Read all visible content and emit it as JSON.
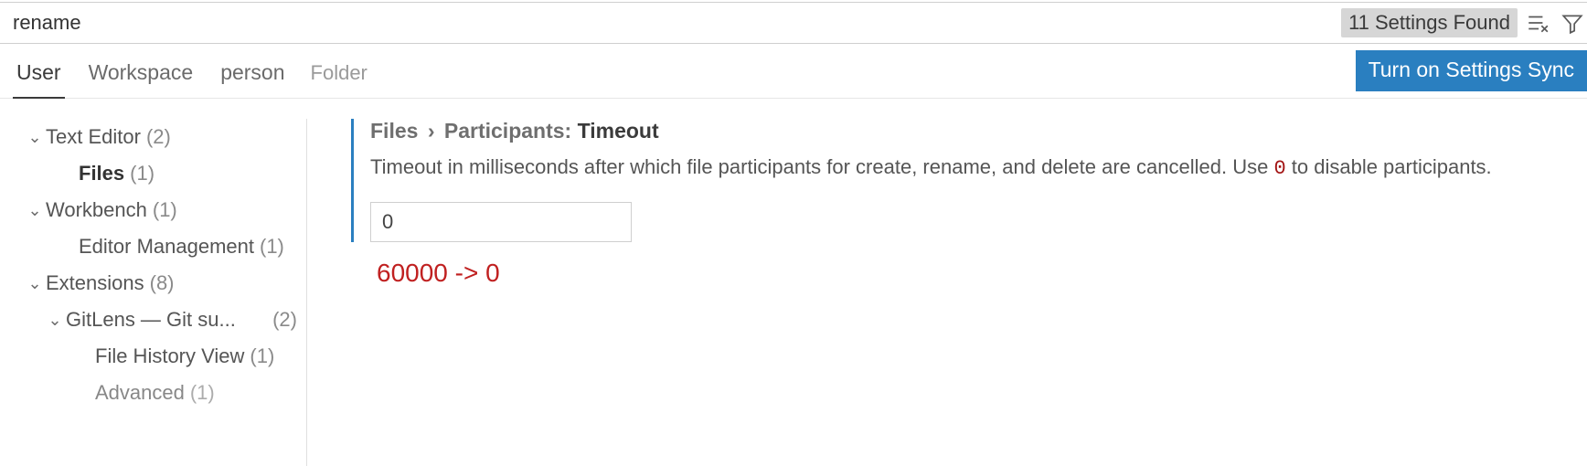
{
  "search": {
    "value": "rename",
    "results_label": "11 Settings Found"
  },
  "scope": {
    "tabs": [
      "User",
      "Workspace",
      "person"
    ],
    "active_index": 0,
    "folder_label": "Folder",
    "sync_button": "Turn on Settings Sync"
  },
  "sidebar": {
    "items": [
      {
        "label": "Text Editor",
        "count": "(2)",
        "indent": 0,
        "chevron": true,
        "bold": false
      },
      {
        "label": "Files",
        "count": "(1)",
        "indent": 1,
        "chevron": false,
        "bold": true
      },
      {
        "label": "Workbench",
        "count": "(1)",
        "indent": 0,
        "chevron": true,
        "bold": false
      },
      {
        "label": "Editor Management",
        "count": "(1)",
        "indent": 1,
        "chevron": false,
        "bold": false
      },
      {
        "label": "Extensions",
        "count": "(8)",
        "indent": 0,
        "chevron": true,
        "bold": false
      },
      {
        "label": "GitLens — Git su...",
        "count": "(2)",
        "indent": 1,
        "chevron": true,
        "bold": false
      },
      {
        "label": "File History View",
        "count": "(1)",
        "indent": 2,
        "chevron": false,
        "bold": false
      },
      {
        "label": "Advanced",
        "count": "(1)",
        "indent": 2,
        "chevron": false,
        "bold": false
      }
    ]
  },
  "setting": {
    "crumb_prefix": "Files",
    "crumb_section": "Participants:",
    "crumb_name": "Timeout",
    "desc_before": "Timeout in milliseconds after which file participants for create, rename, and delete are cancelled. Use ",
    "desc_code": "0",
    "desc_after": " to disable participants.",
    "input_value": "0",
    "annotation": "60000 -> 0"
  }
}
